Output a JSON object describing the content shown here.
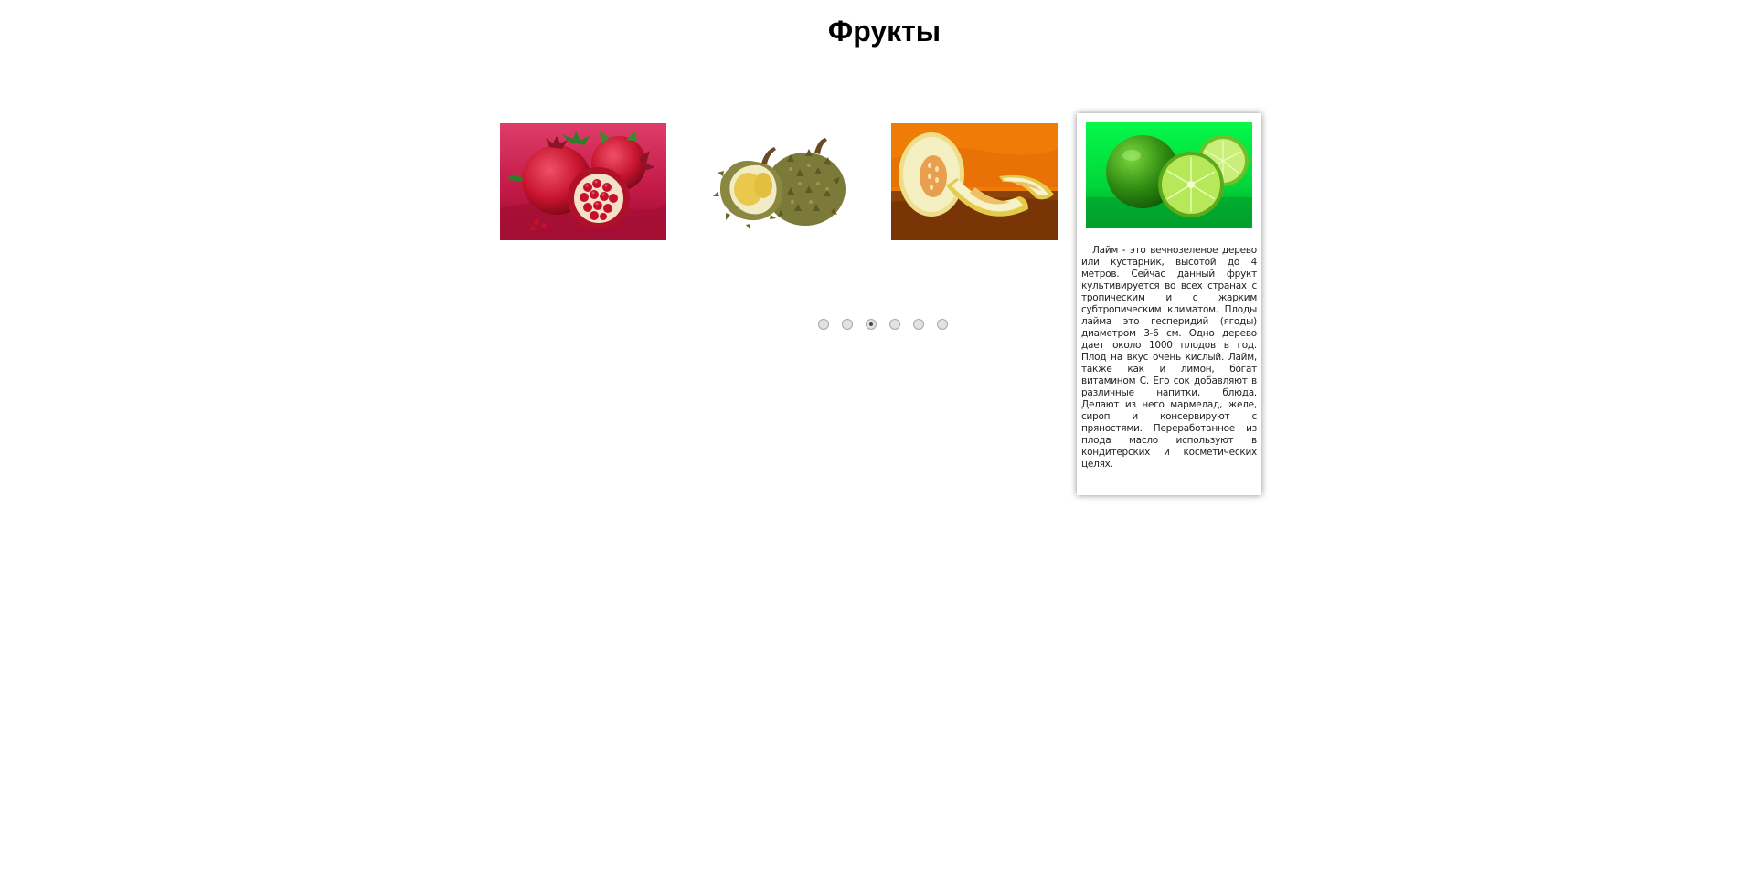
{
  "page": {
    "title": "Фрукты"
  },
  "slider": {
    "active_index": 3,
    "slides": [
      {
        "name": "pomegranate",
        "bg": "#c8204e"
      },
      {
        "name": "durian",
        "bg": "#ffffff"
      },
      {
        "name": "melon",
        "bg": "#f07d06"
      }
    ],
    "card": {
      "name": "lime",
      "bg": "#02e03a",
      "text": "Лайм - это вечнозеленое дерево или кустарник, высотой до 4 метров. Сейчас данный фрукт культивируется во всех странах с тропическим и с жарким субтропическим климатом. Плоды лайма это гесперидий (ягоды) диаметром 3-6 см. Одно дерево дает около 1000 плодов в год. Плод на вкус очень кислый. Лайм, также как и лимон, богат витамином С. Его сок добавляют в различные напитки, блюда. Делают из него мармелад, желе, сироп и консервируют с пряностями. Переработанное из плода масло используют в кондитерских и косметических целях."
    },
    "dots": [
      {
        "active": false
      },
      {
        "active": false
      },
      {
        "active": true
      },
      {
        "active": false
      },
      {
        "active": false
      },
      {
        "active": false
      }
    ]
  }
}
